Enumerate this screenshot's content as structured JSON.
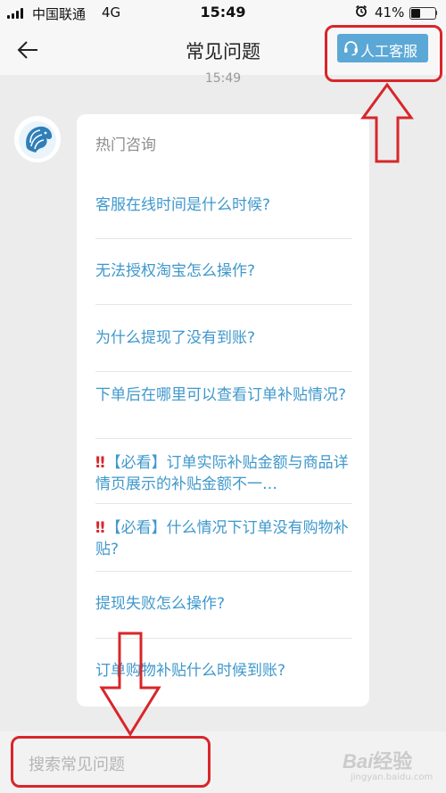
{
  "status_bar": {
    "carrier": "中国联通",
    "network": "4G",
    "time": "15:49",
    "alarm_icon": "alarm-clock-icon",
    "battery_percent": "41%",
    "battery_level": 0.41
  },
  "nav": {
    "back_icon": "back-arrow-icon",
    "title": "常见问题",
    "agent_button": {
      "icon": "headset-icon",
      "label": "人工客服",
      "color": "#5ba8d6"
    }
  },
  "chat": {
    "timestamp": "15:49",
    "bot_avatar_icon": "lion-logo-icon",
    "heading": "热门咨询",
    "questions": [
      {
        "text": "客服在线时间是什么时候?",
        "mark": ""
      },
      {
        "text": "无法授权淘宝怎么操作?",
        "mark": ""
      },
      {
        "text": "为什么提现了没有到账?",
        "mark": ""
      },
      {
        "text": "下单后在哪里可以查看订单补贴情况?",
        "mark": ""
      },
      {
        "text": "【必看】订单实际补贴金额与商品详情页展示的补贴金额不一…",
        "mark": "‼"
      },
      {
        "text": "【必看】什么情况下订单没有购物补贴?",
        "mark": "‼"
      },
      {
        "text": "提现失败怎么操作?",
        "mark": ""
      },
      {
        "text": "订单购物补贴什么时候到账?",
        "mark": ""
      }
    ]
  },
  "footer": {
    "search_placeholder": "搜索常见问题"
  },
  "watermark": {
    "logo": "Bai百经验",
    "sub": "jingyan.baidu.com"
  },
  "colors": {
    "link": "#3f98cc",
    "annotation": "#d8262a",
    "accent": "#5ba8d6"
  }
}
